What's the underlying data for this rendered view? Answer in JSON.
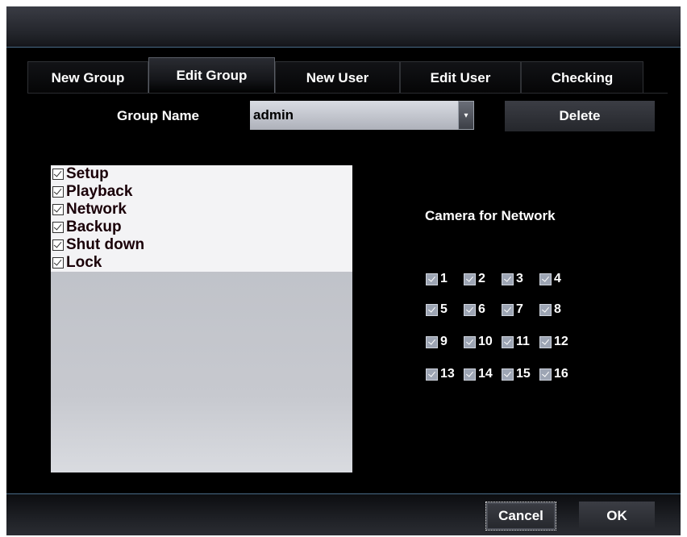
{
  "tabs": [
    {
      "label": "New Group"
    },
    {
      "label": "Edit Group"
    },
    {
      "label": "New User"
    },
    {
      "label": "Edit User"
    },
    {
      "label": "Checking"
    }
  ],
  "active_tab": "Edit Group",
  "group": {
    "label": "Group Name",
    "value": "admin",
    "delete_label": "Delete"
  },
  "permissions": [
    {
      "label": "Setup",
      "checked": true
    },
    {
      "label": "Playback",
      "checked": true
    },
    {
      "label": "Network",
      "checked": true
    },
    {
      "label": "Backup",
      "checked": true
    },
    {
      "label": "Shut down",
      "checked": true
    },
    {
      "label": "Lock",
      "checked": true
    }
  ],
  "cameras": {
    "title": "Camera for Network",
    "items": [
      {
        "label": "1",
        "checked": true
      },
      {
        "label": "2",
        "checked": true
      },
      {
        "label": "3",
        "checked": true
      },
      {
        "label": "4",
        "checked": true
      },
      {
        "label": "5",
        "checked": true
      },
      {
        "label": "6",
        "checked": true
      },
      {
        "label": "7",
        "checked": true
      },
      {
        "label": "8",
        "checked": true
      },
      {
        "label": "9",
        "checked": true
      },
      {
        "label": "10",
        "checked": true
      },
      {
        "label": "11",
        "checked": true
      },
      {
        "label": "12",
        "checked": true
      },
      {
        "label": "13",
        "checked": true
      },
      {
        "label": "14",
        "checked": true
      },
      {
        "label": "15",
        "checked": true
      },
      {
        "label": "16",
        "checked": true
      }
    ]
  },
  "footer": {
    "cancel_label": "Cancel",
    "ok_label": "OK"
  },
  "colors": {
    "dialog_bg": "#000000",
    "accent_line": "#4a6c88",
    "list_bg": "#f3f3f5",
    "list_text": "#1a0008"
  },
  "icons": {
    "combo": "dropdown-arrow-icon",
    "checkbox": "checkmark-icon"
  }
}
